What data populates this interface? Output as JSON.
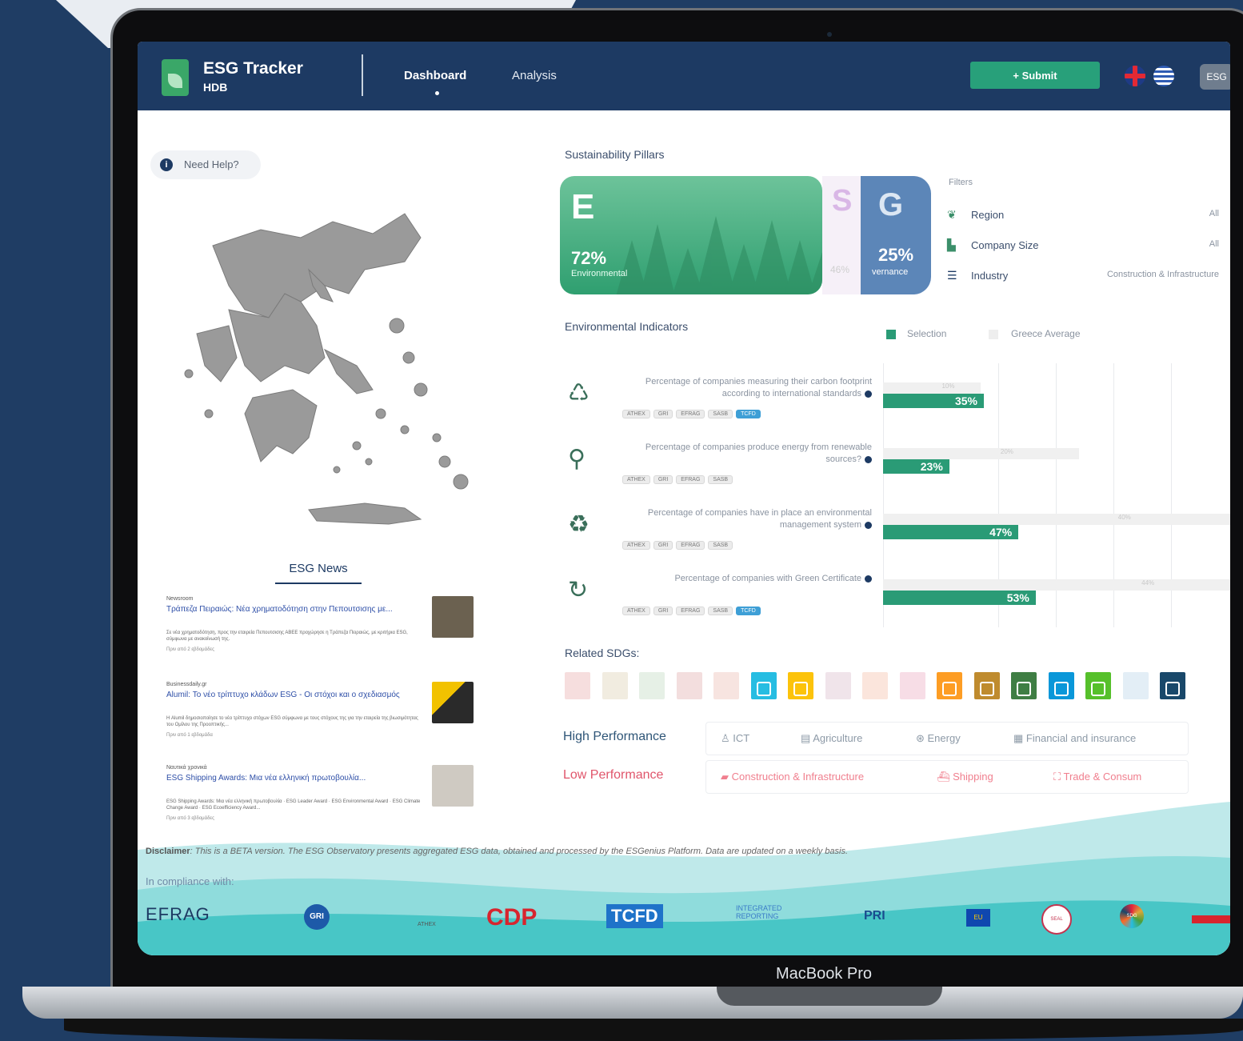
{
  "device": {
    "label": "MacBook Pro"
  },
  "header": {
    "app_title": "ESG Tracker",
    "app_subtitle": "HDB",
    "nav": {
      "dashboard": "Dashboard",
      "analysis": "Analysis"
    },
    "submit_label": "+ Submit",
    "avatar_text": "ESG"
  },
  "help": {
    "label": "Need Help?"
  },
  "news": {
    "title": "ESG News",
    "items": [
      {
        "source": "Newsroom",
        "headline": "Τράπεζα Πειραιώς: Νέα χρηματοδότηση στην Πεπουτσισης με...",
        "body": "Σε νέα χρηματοδότηση, προς την εταιρεία Πεπουτσισης ΑΒΕΕ προχώρησε η Τράπεζα Πειραιώς, με κριτήρια ESG, σύμφωνα με ανακοίνωσή της.",
        "time": "Πριν από 2 εβδομάδες"
      },
      {
        "source": "Businessdaily.gr",
        "headline": "Alumil: Το νέο τρίπτυχο κλάδων ESG - Οι στόχοι και ο σχεδιασμός",
        "body": "Η Alumil δημοσιοποίησε το νέο τρίπτυχο στόχων ESG σύμφωνα με τους στόχους της για την εταιρεία της βιωσιμότητας του Ομίλου της Προοπτικής...",
        "time": "Πριν από 1 εβδομάδα"
      },
      {
        "source": "Ναυτικά χρονικά",
        "headline": "ESG Shipping Awards: Μια νέα ελληνική πρωτοβουλία...",
        "body": "ESG Shipping Awards: Μια νέα ελληνική πρωτοβουλία · ESG Leader Award · ESG Environmental Award · ESG Climate Change Award · ESG Ecoefficiency Award...",
        "time": "Πριν από 3 εβδομάδες"
      }
    ]
  },
  "pillars": {
    "title": "Sustainability Pillars",
    "e": {
      "letter": "E",
      "value": "72%",
      "label": "Environmental"
    },
    "s": {
      "letter": "S",
      "value": "46%"
    },
    "g": {
      "letter": "G",
      "value": "25%",
      "label": "vernance"
    }
  },
  "filters": {
    "title": "Filters",
    "rows": [
      {
        "label": "Region",
        "value": "All",
        "icon": "map-icon"
      },
      {
        "label": "Company Size",
        "value": "All",
        "icon": "building-icon"
      },
      {
        "label": "Industry",
        "value": "Construction & Infrastructure",
        "icon": "menu-icon"
      }
    ]
  },
  "indicators": {
    "title": "Environmental Indicators",
    "legend": {
      "selection": "Selection",
      "average": "Greece Average"
    },
    "colors": {
      "selection": "#2a9b76",
      "average": "#f0f0f0"
    },
    "items": [
      {
        "text": "Percentage of companies measuring their carbon footprint according to international standards",
        "icon": "co2-footprint-icon",
        "selection": 35,
        "average": 10,
        "selection_label": "35%",
        "average_label": "10%",
        "badges": [
          "ATHEX",
          "GRI",
          "EFRAG",
          "SASB",
          "TCFD"
        ]
      },
      {
        "text": "Percentage of companies produce energy from renewable sources?",
        "icon": "wind-turbine-icon",
        "selection": 23,
        "average": 20,
        "selection_label": "23%",
        "average_label": "20%",
        "badges": [
          "ATHEX",
          "GRI",
          "EFRAG",
          "SASB"
        ]
      },
      {
        "text": "Percentage of companies have in place an environmental management system",
        "icon": "recycle-icon",
        "selection": 47,
        "average": 40,
        "selection_label": "47%",
        "average_label": "40%",
        "badges": [
          "ATHEX",
          "GRI",
          "EFRAG",
          "SASB"
        ]
      },
      {
        "text": "Percentage of companies with Green Certificate",
        "icon": "energy-cycle-icon",
        "selection": 53,
        "average": 44,
        "selection_label": "53%",
        "average_label": "44%",
        "badges": [
          "ATHEX",
          "GRI",
          "EFRAG",
          "SASB",
          "TCFD"
        ]
      }
    ]
  },
  "sdgs": {
    "title": "Related SDGs:",
    "tiles": [
      {
        "color": "#f6dede",
        "active": false
      },
      {
        "color": "#f1ece0",
        "active": false
      },
      {
        "color": "#e6f0e6",
        "active": false
      },
      {
        "color": "#f3dede",
        "active": false
      },
      {
        "color": "#f7e4e0",
        "active": false
      },
      {
        "color": "#26bde2",
        "active": true
      },
      {
        "color": "#fcc30b",
        "active": true
      },
      {
        "color": "#f0e4ea",
        "active": false
      },
      {
        "color": "#fbe5dc",
        "active": false
      },
      {
        "color": "#f7dde6",
        "active": false
      },
      {
        "color": "#fd9d24",
        "active": true
      },
      {
        "color": "#bf8b2e",
        "active": true
      },
      {
        "color": "#3f7e44",
        "active": true
      },
      {
        "color": "#0a97d9",
        "active": true
      },
      {
        "color": "#56c02b",
        "active": true
      },
      {
        "color": "#e3eef6",
        "active": false
      },
      {
        "color": "#19486a",
        "active": true
      }
    ]
  },
  "performance": {
    "high": {
      "label": "High Performance",
      "items": [
        "ICT",
        "Agriculture",
        "Energy",
        "Financial and insurance"
      ]
    },
    "low": {
      "label": "Low Performance",
      "items": [
        "Construction & Infrastructure",
        "Shipping",
        "Trade & Consum"
      ]
    }
  },
  "footer": {
    "disclaimer_label": "Disclaimer",
    "disclaimer_text": ": This is a BETA version. The ESG Observatory presents aggregated ESG data, obtained and processed by the ESGenius Platform. Data are updated on a weekly basis.",
    "compliance": "In compliance with:",
    "logos": [
      "EFRAG",
      "GRI",
      "ATHEX",
      "CDP",
      "TCFD",
      "INTEGRATED REPORTING",
      "PRI",
      "EU",
      "SEAL",
      "SDG"
    ]
  }
}
